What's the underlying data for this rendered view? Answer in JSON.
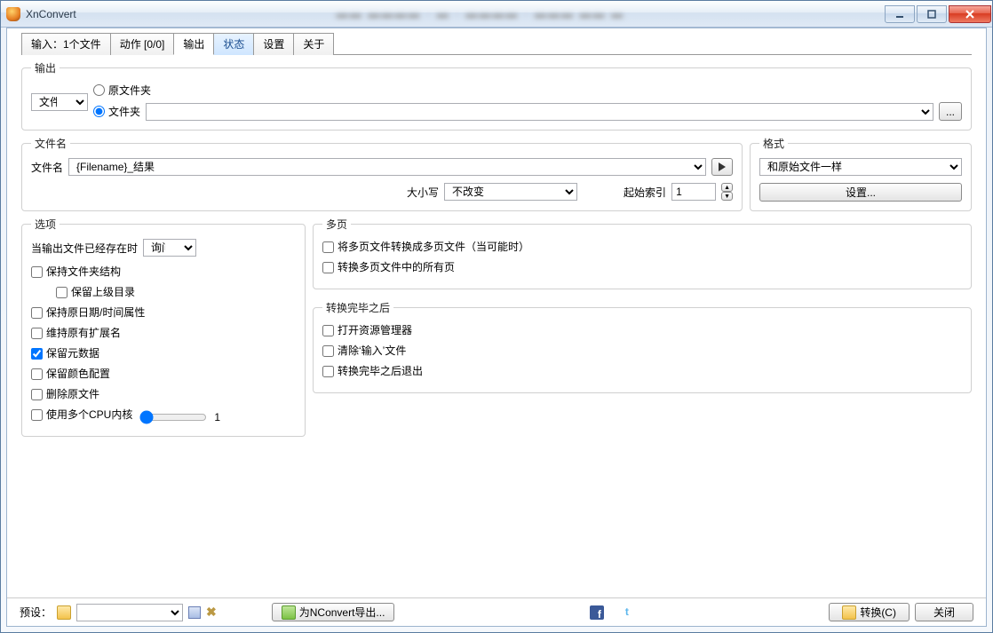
{
  "window": {
    "title": "XnConvert"
  },
  "tabs": {
    "input": "输入：1个文件",
    "actions": "动作 [0/0]",
    "output": "输出",
    "status": "状态",
    "settings": "设置",
    "about": "关于"
  },
  "output": {
    "legend": "输出",
    "dest_select": "文件夹",
    "radio_original": "原文件夹",
    "radio_folder": "文件夹",
    "folder_path": "",
    "browse": "..."
  },
  "filename": {
    "legend": "文件名",
    "label": "文件名",
    "pattern": "{Filename}_结果",
    "case_label": "大小写",
    "case_value": "不改变",
    "start_index_label": "起始索引",
    "start_index_value": "1"
  },
  "format": {
    "legend": "格式",
    "value": "和原始文件一样",
    "settings_btn": "设置..."
  },
  "options": {
    "legend": "选项",
    "when_exists_label": "当输出文件已经存在时",
    "when_exists_value": "询问",
    "keep_folder_structure": "保持文件夹结构",
    "keep_parent_dir": "保留上级目录",
    "keep_datetime": "保持原日期/时间属性",
    "keep_extension": "维持原有扩展名",
    "keep_metadata": "保留元数据",
    "keep_color_profile": "保留颜色配置",
    "delete_original": "删除原文件",
    "use_multi_cpu": "使用多个CPU内核",
    "cpu_value": "1"
  },
  "multipage": {
    "legend": "多页",
    "convert_to_multipage": "将多页文件转换成多页文件（当可能时）",
    "convert_all_pages": "转换多页文件中的所有页"
  },
  "after": {
    "legend": "转换完毕之后",
    "open_explorer": "打开资源管理器",
    "clear_input": "清除‘输入’文件",
    "exit_after": "转换完毕之后退出"
  },
  "footer": {
    "preset_label": "预设：",
    "preset_value": "",
    "export_label": "为NConvert导出...",
    "convert_btn": "转换(C)",
    "close_btn": "关闭"
  }
}
